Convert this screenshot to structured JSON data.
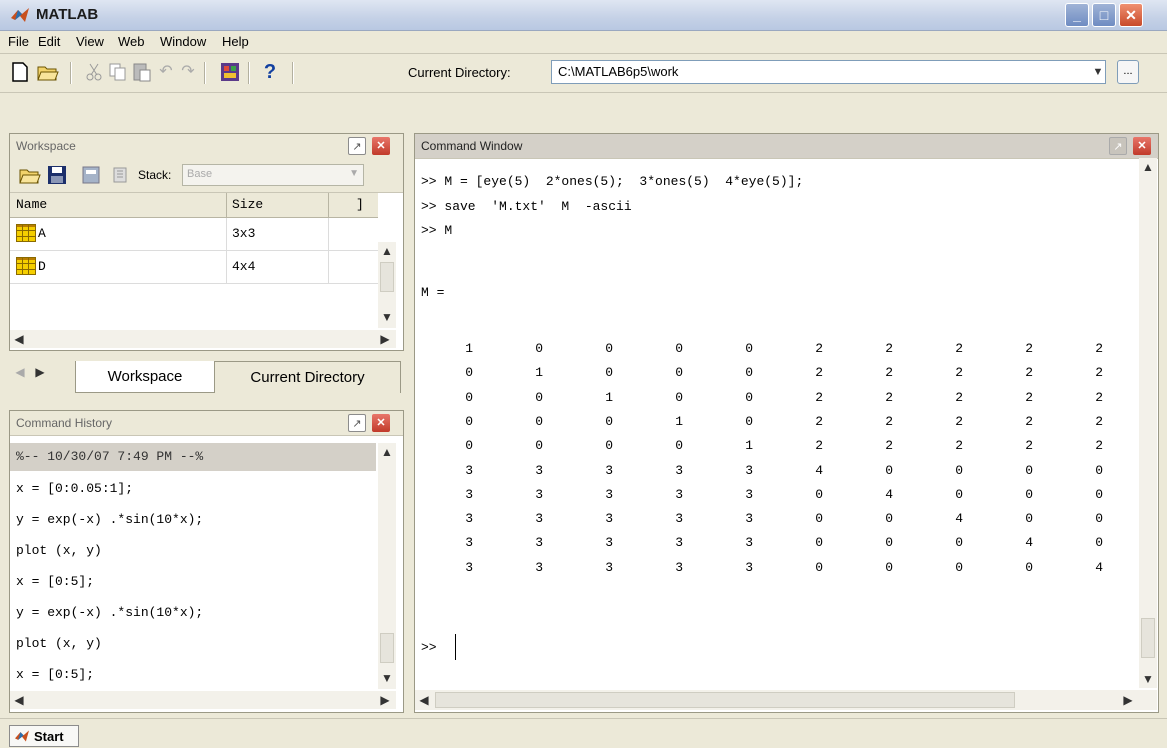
{
  "window": {
    "title": "MATLAB"
  },
  "menu": [
    "File",
    "Edit",
    "View",
    "Web",
    "Window",
    "Help"
  ],
  "toolbar": {
    "current_directory_label": "Current Directory:",
    "current_directory_value": "C:\\MATLAB6p5\\work",
    "browse_label": "..."
  },
  "workspace": {
    "title": "Workspace",
    "stack_label": "Stack:",
    "stack_value": "Base",
    "columns": [
      "Name",
      "Size",
      "]"
    ],
    "rows": [
      {
        "name": "A",
        "size": "3x3"
      },
      {
        "name": "D",
        "size": "4x4"
      }
    ]
  },
  "tabs": [
    "Workspace",
    "Current Directory"
  ],
  "history": {
    "title": "Command History",
    "lines": [
      "%-- 10/30/07   7:49 PM --%",
      "x = [0:0.05:1];",
      "y = exp(-x) .*sin(10*x);",
      "plot (x, y)",
      "x = [0:5];",
      "y = exp(-x) .*sin(10*x);",
      "plot (x, y)",
      "x = [0:5];"
    ]
  },
  "command_window": {
    "title": "Command Window",
    "lines": [
      ">> M = [eye(5)  2*ones(5);  3*ones(5)  4*eye(5)];",
      ">> save  'M.txt'  M  -ascii",
      ">> M"
    ],
    "matrix_label": "M =",
    "matrix": [
      [
        "1",
        "0",
        "0",
        "0",
        "0",
        "2",
        "2",
        "2",
        "2",
        "2"
      ],
      [
        "0",
        "1",
        "0",
        "0",
        "0",
        "2",
        "2",
        "2",
        "2",
        "2"
      ],
      [
        "0",
        "0",
        "1",
        "0",
        "0",
        "2",
        "2",
        "2",
        "2",
        "2"
      ],
      [
        "0",
        "0",
        "0",
        "1",
        "0",
        "2",
        "2",
        "2",
        "2",
        "2"
      ],
      [
        "0",
        "0",
        "0",
        "0",
        "1",
        "2",
        "2",
        "2",
        "2",
        "2"
      ],
      [
        "3",
        "3",
        "3",
        "3",
        "3",
        "4",
        "0",
        "0",
        "0",
        "0"
      ],
      [
        "3",
        "3",
        "3",
        "3",
        "3",
        "0",
        "4",
        "0",
        "0",
        "0"
      ],
      [
        "3",
        "3",
        "3",
        "3",
        "3",
        "0",
        "0",
        "4",
        "0",
        "0"
      ],
      [
        "3",
        "3",
        "3",
        "3",
        "3",
        "0",
        "0",
        "0",
        "4",
        "0"
      ],
      [
        "3",
        "3",
        "3",
        "3",
        "3",
        "0",
        "0",
        "0",
        "0",
        "4"
      ]
    ],
    "prompt": ">>"
  },
  "start_button": "Start"
}
